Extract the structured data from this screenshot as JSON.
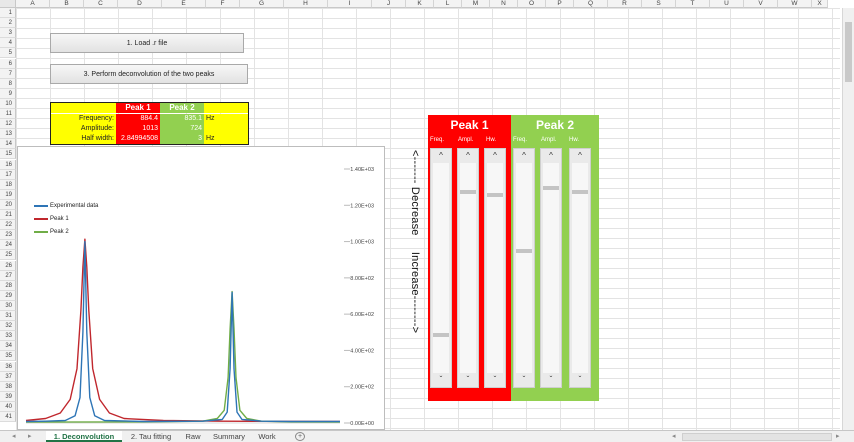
{
  "columns": [
    "A",
    "B",
    "C",
    "D",
    "E",
    "F",
    "G",
    "H",
    "I",
    "J",
    "K",
    "L",
    "M",
    "N",
    "O",
    "P",
    "Q",
    "R",
    "S",
    "T",
    "U",
    "V",
    "W",
    "X"
  ],
  "rows": [
    "1",
    "2",
    "3",
    "4",
    "5",
    "6",
    "7",
    "8",
    "9",
    "10",
    "11",
    "12",
    "13",
    "14",
    "15",
    "16",
    "17",
    "18",
    "19",
    "20",
    "21",
    "22",
    "23",
    "24",
    "25",
    "26",
    "27",
    "28",
    "29",
    "30",
    "31",
    "32",
    "33",
    "34",
    "35",
    "36",
    "37",
    "38",
    "39",
    "40",
    "41"
  ],
  "buttons": {
    "load": "1. Load .r file",
    "deconvolve": "3. Perform deconvolution of the two peaks"
  },
  "param_table": {
    "peak1_header": "Peak 1",
    "peak2_header": "Peak 2",
    "rows": [
      {
        "label": "Frequency:",
        "peak1": "884.4",
        "peak2": "835.1",
        "unit": "Hz"
      },
      {
        "label": "Amplitude:",
        "peak1": "1013",
        "peak2": "724",
        "unit": ""
      },
      {
        "label": "Half width:",
        "peak1": "2.84994508",
        "peak2": "3",
        "unit": "Hz"
      }
    ]
  },
  "chart": {
    "y_ticks": [
      "1.40E+03",
      "1.20E+03",
      "1.00E+03",
      "8.00E+02",
      "6.00E+02",
      "4.00E+02",
      "2.00E+02",
      "0.00E+00"
    ],
    "legend": [
      "Experimental data",
      "Peak 1",
      "Peak 2"
    ],
    "colors": {
      "experimental": "#2e75b6",
      "peak1": "#c0272d",
      "peak2": "#70ad47"
    }
  },
  "chart_data": {
    "type": "line",
    "ylim": [
      0,
      1400
    ],
    "yticks": [
      0,
      200,
      400,
      600,
      800,
      1000,
      1200,
      1400
    ],
    "series": [
      {
        "name": "Experimental data",
        "points": [
          [
            0,
            8
          ],
          [
            20,
            10
          ],
          [
            40,
            14
          ],
          [
            50,
            40
          ],
          [
            55,
            140
          ],
          [
            58,
            500
          ],
          [
            60,
            1000
          ],
          [
            62,
            500
          ],
          [
            65,
            140
          ],
          [
            70,
            40
          ],
          [
            80,
            14
          ],
          [
            120,
            8
          ],
          [
            180,
            10
          ],
          [
            200,
            20
          ],
          [
            205,
            60
          ],
          [
            208,
            300
          ],
          [
            210,
            720
          ],
          [
            212,
            300
          ],
          [
            215,
            60
          ],
          [
            220,
            20
          ],
          [
            240,
            10
          ],
          [
            270,
            8
          ],
          [
            320,
            8
          ]
        ]
      },
      {
        "name": "Peak 1",
        "points": [
          [
            0,
            14
          ],
          [
            20,
            25
          ],
          [
            35,
            55
          ],
          [
            45,
            130
          ],
          [
            52,
            300
          ],
          [
            56,
            620
          ],
          [
            58,
            860
          ],
          [
            60,
            1013
          ],
          [
            62,
            860
          ],
          [
            64,
            620
          ],
          [
            68,
            300
          ],
          [
            75,
            130
          ],
          [
            85,
            55
          ],
          [
            100,
            25
          ],
          [
            140,
            14
          ],
          [
            200,
            10
          ],
          [
            320,
            8
          ]
        ]
      },
      {
        "name": "Peak 2",
        "points": [
          [
            0,
            5
          ],
          [
            120,
            6
          ],
          [
            180,
            10
          ],
          [
            195,
            25
          ],
          [
            202,
            70
          ],
          [
            206,
            250
          ],
          [
            208,
            520
          ],
          [
            210,
            724
          ],
          [
            212,
            520
          ],
          [
            214,
            250
          ],
          [
            218,
            70
          ],
          [
            225,
            25
          ],
          [
            240,
            10
          ],
          [
            270,
            6
          ],
          [
            320,
            5
          ]
        ]
      }
    ]
  },
  "side_text": "<------- Decrease     Increase-------->",
  "peaks_panel": {
    "peak1": {
      "title": "Peak 1",
      "labels": [
        "Freq.",
        "Ampl.",
        "Hw."
      ],
      "color": "#ff0000"
    },
    "peak2": {
      "title": "Peak 2",
      "labels": [
        "Freq.",
        "Ampl.",
        "Hw."
      ],
      "color": "#92d050"
    }
  },
  "slider_positions": {
    "peak1": [
      0.82,
      0.14,
      0.15
    ],
    "peak2": [
      0.42,
      0.12,
      0.14
    ]
  },
  "slider_glyphs": {
    "up": "^",
    "down": "ˇ"
  },
  "tabs": [
    "1. Deconvolution",
    "2. Tau fitting",
    "Raw",
    "Summary",
    "Work"
  ],
  "tab_active": "1. Deconvolution",
  "add_sheet": "+",
  "nav": {
    "prev": "◂",
    "next": "▸",
    "scroll_left": "◂",
    "scroll_right": "▸"
  }
}
